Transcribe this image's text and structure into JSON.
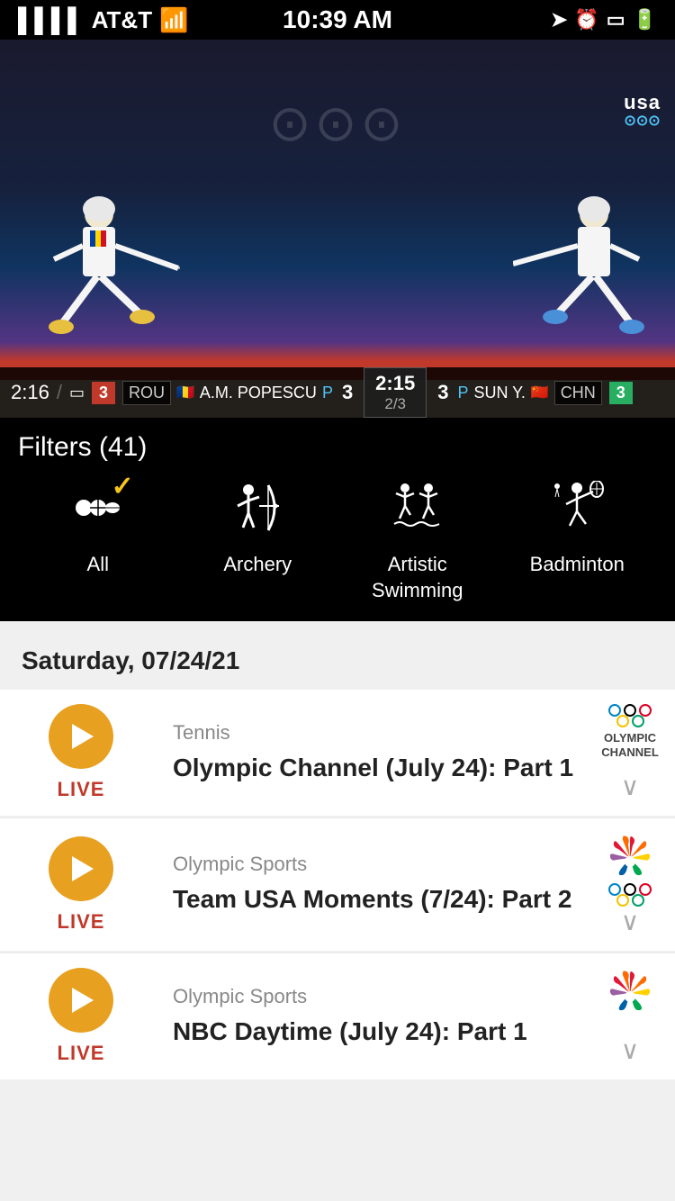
{
  "statusBar": {
    "carrier": "AT&T",
    "time": "10:39 AM",
    "signal": "●●●●",
    "wifi": "WiFi"
  },
  "videoPlayer": {
    "usaLogo": "usa",
    "olympicsText": "∞∞∞",
    "scoreLeft": {
      "time": "2:16",
      "country": "ROU",
      "flag": "🇷🇴",
      "player": "A.M. POPESCU",
      "indicator": "P",
      "score": "3"
    },
    "scoreCenter": {
      "time": "2:15",
      "round": "2/3"
    },
    "scoreRight": {
      "score": "3",
      "indicator": "P",
      "player": "SUN Y.",
      "country": "CHN",
      "flag": "🇨🇳"
    }
  },
  "filters": {
    "title": "Filters (41)",
    "items": [
      {
        "id": "all",
        "label": "All",
        "selected": true
      },
      {
        "id": "archery",
        "label": "Archery",
        "selected": false
      },
      {
        "id": "artistic-swimming",
        "label": "Artistic\nSwimming",
        "selected": false
      },
      {
        "id": "badminton",
        "label": "Badminton",
        "selected": false
      }
    ]
  },
  "dateHeader": "Saturday, 07/24/21",
  "contentItems": [
    {
      "id": "item1",
      "sport": "Tennis",
      "title": "Olympic Channel (July 24): Part 1",
      "status": "LIVE",
      "channel": "OLYMPIC CHANNEL",
      "channelType": "olympic"
    },
    {
      "id": "item2",
      "sport": "Olympic Sports",
      "title": "Team USA Moments (7/24): Part 2",
      "status": "LIVE",
      "channel": "NBC",
      "channelType": "nbc"
    },
    {
      "id": "item3",
      "sport": "Olympic Sports",
      "title": "NBC Daytime (July 24): Part 1",
      "status": "LIVE",
      "channel": "NBC",
      "channelType": "nbc"
    }
  ]
}
